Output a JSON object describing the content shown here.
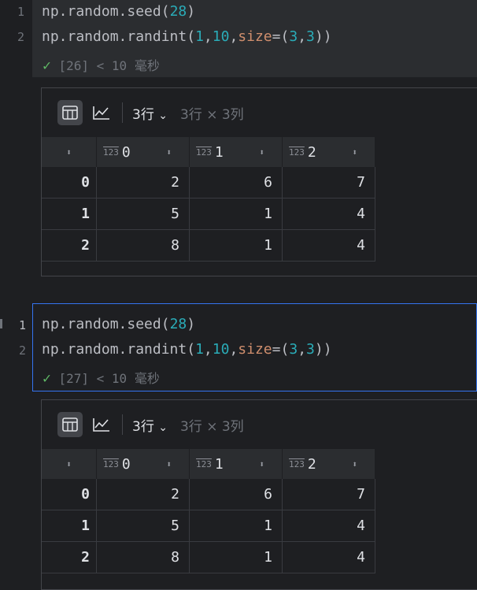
{
  "cells": [
    {
      "gutter": [
        "1",
        "2"
      ],
      "code": {
        "line1": {
          "a": "np.random.seed(",
          "n": "28",
          "b": ")"
        },
        "line2": {
          "a": "np.random.randint(",
          "n1": "1",
          "c1": ",",
          "n2": "10",
          "c2": ",",
          "kw": "size",
          "eq": "=(",
          "n3": "3",
          "c3": ",",
          "n4": "3",
          "b": "))"
        }
      },
      "status": {
        "check": "✓",
        "text": "[26] < 10 毫秒"
      },
      "output": {
        "rows_label": "3行",
        "rows_chevron": "⌄",
        "shape_text": "3行 × 3列",
        "columns": [
          "0",
          "1",
          "2"
        ],
        "type_icon": "123",
        "index": [
          "0",
          "1",
          "2"
        ],
        "rows": [
          [
            "2",
            "6",
            "7"
          ],
          [
            "5",
            "1",
            "4"
          ],
          [
            "8",
            "1",
            "4"
          ]
        ]
      }
    },
    {
      "gutter": [
        "1",
        "2"
      ],
      "code": {
        "line1": {
          "a": "np.random.seed(",
          "n": "28",
          "b": ")"
        },
        "line2": {
          "a": "np.random.randint(",
          "n1": "1",
          "c1": ",",
          "n2": "10",
          "c2": ",",
          "kw": "size",
          "eq": "=(",
          "n3": "3",
          "c3": ",",
          "n4": "3",
          "b": "))"
        }
      },
      "status": {
        "check": "✓",
        "text": "[27] < 10 毫秒"
      },
      "output": {
        "rows_label": "3行",
        "rows_chevron": "⌄",
        "shape_text": "3行 × 3列",
        "columns": [
          "0",
          "1",
          "2"
        ],
        "type_icon": "123",
        "index": [
          "0",
          "1",
          "2"
        ],
        "rows": [
          [
            "2",
            "6",
            "7"
          ],
          [
            "5",
            "1",
            "4"
          ],
          [
            "8",
            "1",
            "4"
          ]
        ]
      }
    }
  ],
  "colors": {
    "accent": "#3574f0",
    "success": "#5fb865",
    "number": "#2aacb8",
    "keyword": "#cf8e6d"
  }
}
